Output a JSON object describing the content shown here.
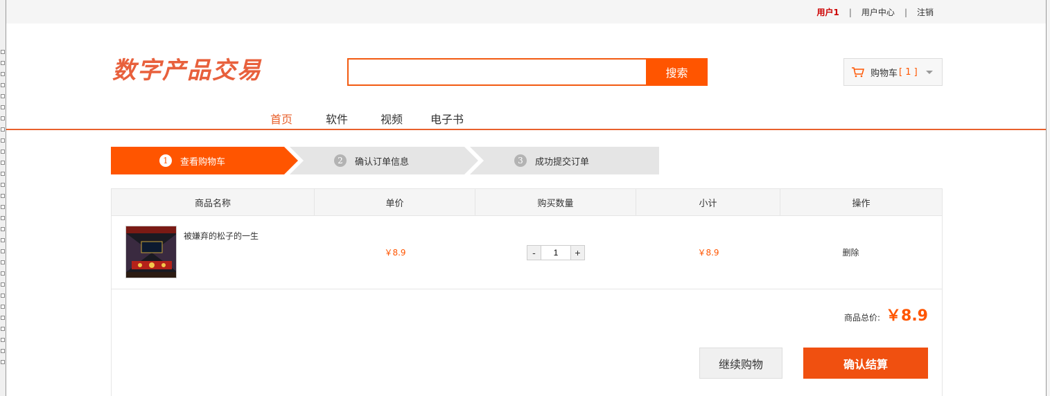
{
  "topbar": {
    "username": "用户1",
    "separator": "|",
    "user_center": "用户中心",
    "logout": "注销"
  },
  "header": {
    "logo_text": "数字产品交易",
    "search_placeholder": "",
    "search_button": "搜索",
    "cart_label": "购物车",
    "cart_count": "[ 1 ]",
    "cart_icon": "cart-icon"
  },
  "nav": {
    "items": [
      "首页",
      "软件",
      "视频",
      "电子书"
    ],
    "active": "首页"
  },
  "steps": [
    {
      "num": "1",
      "label": "查看购物车",
      "active": true
    },
    {
      "num": "2",
      "label": "确认订单信息",
      "active": false
    },
    {
      "num": "3",
      "label": "成功提交订单",
      "active": false
    }
  ],
  "table": {
    "headers": [
      "商品名称",
      "单价",
      "购买数量",
      "小计",
      "操作"
    ],
    "rows": [
      {
        "name": "被嫌弃的松子的一生",
        "price": "￥8.9",
        "quantity": "1",
        "subtotal": "￥8.9",
        "action": "删除"
      }
    ],
    "minus": "-",
    "plus": "+"
  },
  "summary": {
    "total_label": "商品总价:",
    "total_amount": "￥8.9",
    "continue_button": "继续购物",
    "checkout_button": "确认结算"
  },
  "colors": {
    "accent": "#ff5500",
    "nav_active": "#e8602c",
    "logo": "#e8603c"
  }
}
